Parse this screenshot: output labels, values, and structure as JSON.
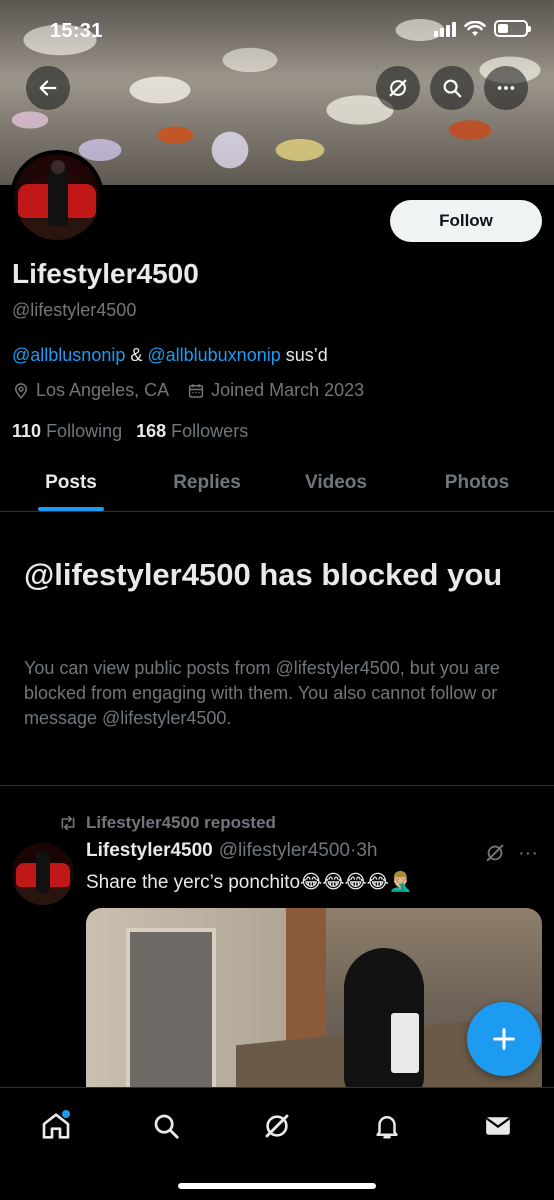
{
  "status_bar": {
    "time": "15:31"
  },
  "header": {
    "back_icon": "back-arrow-icon",
    "grok_icon": "grok-icon",
    "search_icon": "search-icon",
    "more_icon": "more-icon"
  },
  "profile": {
    "follow_label": "Follow",
    "display_name": "Lifestyler4500",
    "handle": "@lifestyler4500",
    "bio_link_1": "@allblusnonip",
    "bio_amp": " & ",
    "bio_link_2": "@allblubuxnonip",
    "bio_rest": " sus’d",
    "location": "Los Angeles, CA",
    "joined": "Joined March 2023",
    "following_count": "110",
    "following_label": "Following",
    "followers_count": "168",
    "followers_label": "Followers"
  },
  "tabs": [
    {
      "label": "Posts",
      "active": true
    },
    {
      "label": "Replies",
      "active": false
    },
    {
      "label": "Videos",
      "active": false
    },
    {
      "label": "Photos",
      "active": false
    }
  ],
  "blocked": {
    "title": "@lifestyler4500 has blocked you",
    "body": "You can view public posts from @lifestyler4500, but you are blocked from engaging with them. You also cannot follow or message @lifestyler4500."
  },
  "post": {
    "repost_label": "Lifestyler4500 reposted",
    "author_name": "Lifestyler4500",
    "author_handle": "@lifestyler4500",
    "separator": "·",
    "time": "3h",
    "more": "···",
    "text": "Share the yerc’s ponchito😂😂😂😂🤦🏼‍♂️"
  },
  "colors": {
    "accent": "#1d9bf0",
    "background": "#000000",
    "primary_text": "#e7e9ea",
    "secondary_text": "#71767b"
  }
}
